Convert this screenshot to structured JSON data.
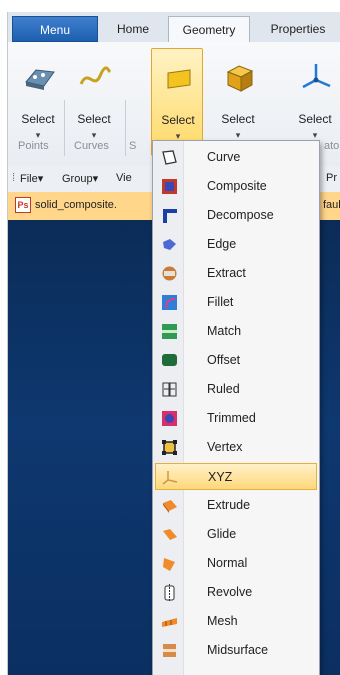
{
  "tabs": {
    "menu": "Menu",
    "home": "Home",
    "geometry": "Geometry",
    "properties": "Properties"
  },
  "ribbon": {
    "buttons": [
      {
        "label": "Select",
        "group": "Points"
      },
      {
        "label": "Select",
        "group": "Curves"
      },
      {
        "label": "Select",
        "group": "S"
      },
      {
        "label": "Select",
        "group": ""
      },
      {
        "label": "Select",
        "group": "ator"
      }
    ],
    "arrow": "▾"
  },
  "toolbar2": {
    "items": [
      "File▾",
      "Group▾",
      "Vie"
    ],
    "right": "Pr"
  },
  "doc_tab": {
    "icon_text": "Ps",
    "name": "solid_composite.",
    "right": "faul"
  },
  "dropdown": {
    "items": [
      {
        "label": "Curve",
        "icon": "curve-icon"
      },
      {
        "label": "Composite",
        "icon": "composite-icon"
      },
      {
        "label": "Decompose",
        "icon": "decompose-icon"
      },
      {
        "label": "Edge",
        "icon": "edge-icon"
      },
      {
        "label": "Extract",
        "icon": "extract-icon"
      },
      {
        "label": "Fillet",
        "icon": "fillet-icon"
      },
      {
        "label": "Match",
        "icon": "match-icon"
      },
      {
        "label": "Offset",
        "icon": "offset-icon"
      },
      {
        "label": "Ruled",
        "icon": "ruled-icon"
      },
      {
        "label": "Trimmed",
        "icon": "trimmed-icon"
      },
      {
        "label": "Vertex",
        "icon": "vertex-icon"
      },
      {
        "label": "XYZ",
        "icon": "xyz-icon",
        "highlighted": true
      },
      {
        "label": "Extrude",
        "icon": "extrude-icon"
      },
      {
        "label": "Glide",
        "icon": "glide-icon"
      },
      {
        "label": "Normal",
        "icon": "normal-icon"
      },
      {
        "label": "Revolve",
        "icon": "revolve-icon"
      },
      {
        "label": "Mesh",
        "icon": "mesh-icon"
      },
      {
        "label": "Midsurface",
        "icon": "midsurface-icon"
      }
    ]
  },
  "colors": {
    "menu_tab": "#1f5fb0",
    "active_highlight": "#ffd966",
    "viewport": "#0e3870",
    "doc_tab": "#ffd68a"
  }
}
